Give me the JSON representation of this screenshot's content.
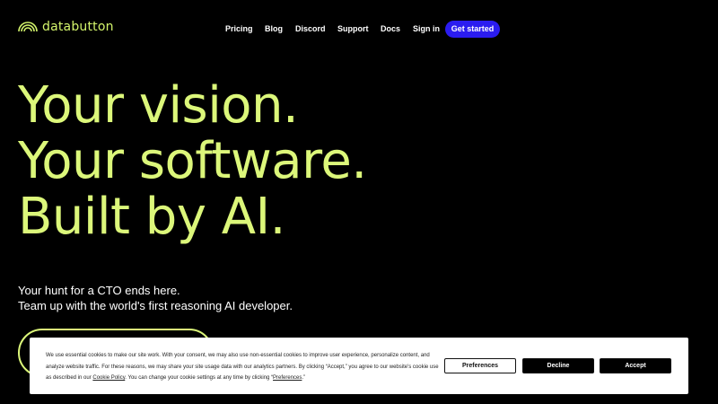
{
  "header": {
    "logo_text": "databutton",
    "nav": [
      {
        "label": "Pricing",
        "name": "nav-pricing"
      },
      {
        "label": "Blog",
        "name": "nav-blog"
      },
      {
        "label": "Discord",
        "name": "nav-discord"
      },
      {
        "label": "Support",
        "name": "nav-support"
      },
      {
        "label": "Docs",
        "name": "nav-docs"
      },
      {
        "label": "Sign in",
        "name": "nav-sign-in"
      }
    ],
    "cta_label": "Get started"
  },
  "hero": {
    "line1": "Your vision.",
    "line2": "Your software.",
    "line3": "Built by AI.",
    "sub1": "Your hunt for a CTO ends here.",
    "sub2": "Team up with the world's first reasoning AI developer."
  },
  "cookie": {
    "text_part1": "We use essential cookies to make our site work. With your consent, we may also use non-essential cookies to improve user experience, personalize content, and analyze website traffic. For these reasons, we may share your site usage data with our analytics partners. By clicking “Accept,” you agree to our website's cookie use as described in our ",
    "policy_link": "Cookie Policy",
    "text_part2": ". You can change your cookie settings at any time by clicking “",
    "preferences_link": "Preferences",
    "text_part3": ".”",
    "preferences_label": "Preferences",
    "decline_label": "Decline",
    "accept_label": "Accept"
  },
  "colors": {
    "accent_lime": "#dcf77a",
    "cta_blue": "#2b1cf0",
    "background": "#000000"
  }
}
